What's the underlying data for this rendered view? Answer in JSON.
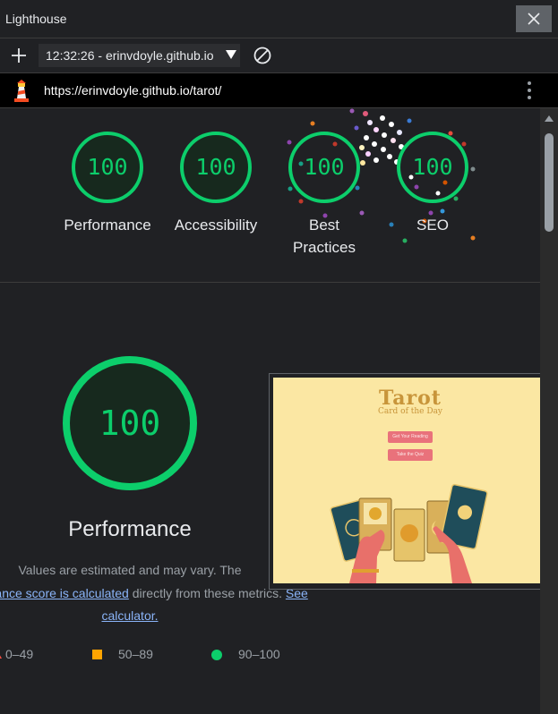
{
  "window": {
    "title": "Lighthouse",
    "close_icon": "close-icon"
  },
  "toolbar": {
    "new_report_icon": "plus-icon",
    "report_select_value": "12:32:26 - erinvdoyle.github.io",
    "report_select_icon": "caret-down-icon",
    "clear_icon": "block-icon"
  },
  "urlbar": {
    "logo_icon": "lighthouse-icon",
    "url": "https://erinvdoyle.github.io/tarot/",
    "menu_icon": "kebab-menu-icon"
  },
  "colors": {
    "pass": "#0cce6b",
    "average": "#ffa400",
    "fail": "#ff4e42",
    "background": "#202124",
    "link": "#8ab4f8"
  },
  "scores": [
    {
      "label": "Performance",
      "value": "100"
    },
    {
      "label": "Accessibility",
      "value": "100"
    },
    {
      "label": "Best Practices",
      "label_line1": "Best",
      "label_line2": "Practices",
      "value": "100"
    },
    {
      "label": "SEO",
      "value": "100"
    }
  ],
  "performance": {
    "score": "100",
    "title": "Performance",
    "desc_part1": "Values are estimated and may vary. The",
    "desc_link1": "performance score is calculated",
    "desc_part2": "directly from these metrics.",
    "desc_link2": "See calculator."
  },
  "legend": [
    {
      "shape": "triangle",
      "range": "0–49"
    },
    {
      "shape": "square",
      "range": "50–89"
    },
    {
      "shape": "circle",
      "range": "90–100"
    }
  ],
  "screenshot": {
    "site_title": "Tarot",
    "site_subtitle": "Card of the Day",
    "button1": "Get Your Reading",
    "button2": "Take the Quiz"
  }
}
